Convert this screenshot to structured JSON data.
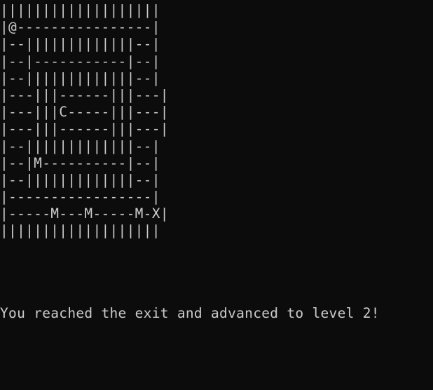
{
  "maze": {
    "rows": [
      "|||||||||||||||||||",
      "|@----------------|",
      "|--|||||||||||||--|",
      "|--|-----------|--|",
      "|--|||||||||||||--|",
      "|---|||------|||---|",
      "|---|||C-----|||---|",
      "|---|||------|||---|",
      "|--|||||||||||||--|",
      "|--|M----------|--|",
      "|--|||||||||||||--|",
      "|-----------------|",
      "|-----M---M-----M-X|",
      "|||||||||||||||||||"
    ]
  },
  "message": "You reached the exit and advanced to level 2!"
}
